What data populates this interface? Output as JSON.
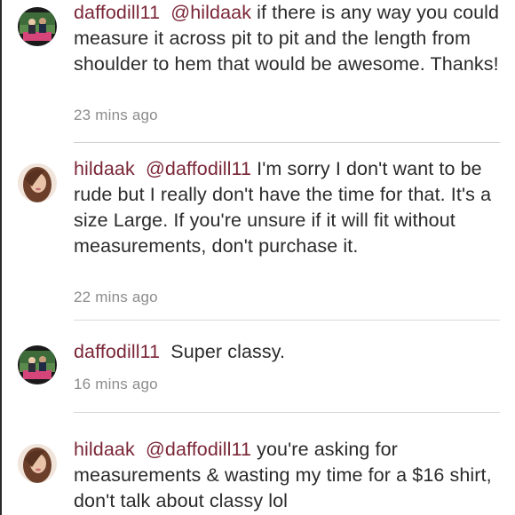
{
  "comments": [
    {
      "user": "daffodill11",
      "mention": "@hildaak",
      "text": " if there is any way you could measure it across pit to pit and the length from shoulder to hem that would be awesome. Thanks!",
      "time": "23 mins ago",
      "avatar": "daffodill11-avatar"
    },
    {
      "user": "hildaak",
      "mention": "@daffodill11",
      "text": " I'm sorry I don't want to be rude but I really don't have the time for that. It's a size Large. If you're unsure if it will fit without measurements, don't purchase it.",
      "time": "22 mins ago",
      "avatar": "hildaak-avatar"
    },
    {
      "user": "daffodill11",
      "mention": "",
      "text": "Super classy.",
      "time": "16 mins ago",
      "avatar": "daffodill11-avatar"
    },
    {
      "user": "hildaak",
      "mention": "@daffodill11",
      "text": " you're asking for measurements & wasting my time for a $16 shirt, don't talk about classy lol",
      "time": "",
      "avatar": "hildaak-avatar"
    }
  ],
  "colors": {
    "username": "#7a2636",
    "body_text": "#2b2b2b",
    "timestamp": "#8c8c8c",
    "divider": "#d9d9d9"
  }
}
